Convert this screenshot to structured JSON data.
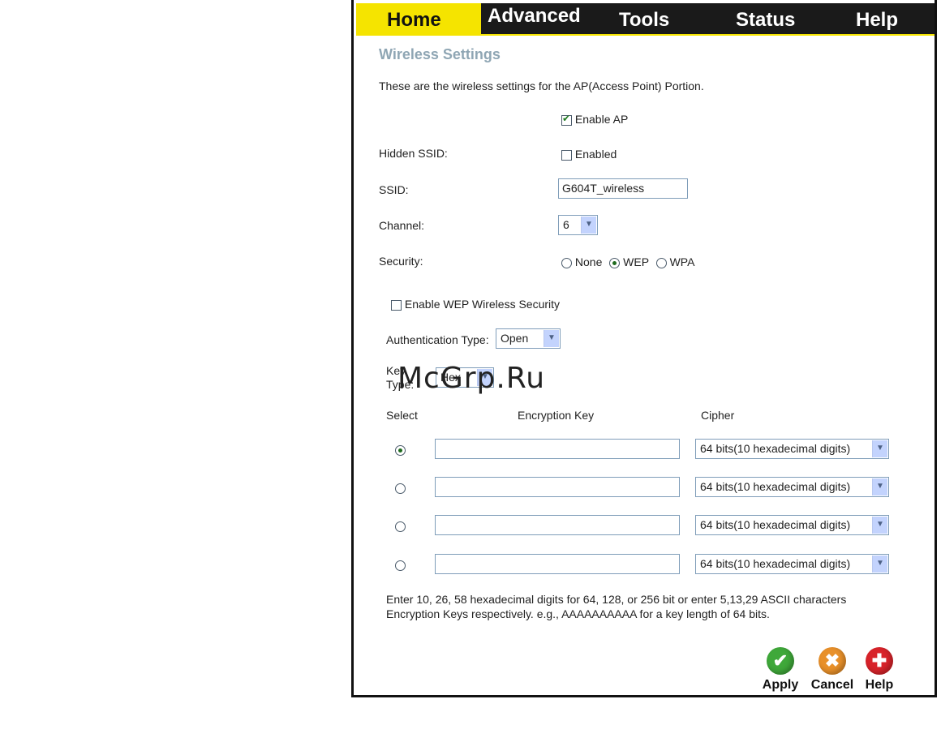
{
  "nav": {
    "tabs": [
      {
        "label": "Home"
      },
      {
        "label": "Advanced"
      },
      {
        "label": "Tools"
      },
      {
        "label": "Status"
      },
      {
        "label": "Help"
      }
    ]
  },
  "page": {
    "title": "Wireless Settings",
    "description": "These are the wireless settings for the AP(Access Point) Portion."
  },
  "form": {
    "enable_ap_label": "Enable AP",
    "enable_ap_checked": true,
    "hidden_ssid_label": "Hidden SSID:",
    "hidden_ssid_option": "Enabled",
    "ssid_label": "SSID:",
    "ssid_value": "G604T_wireless",
    "channel_label": "Channel:",
    "channel_value": "6",
    "security_label": "Security:",
    "security_options": [
      "None",
      "WEP",
      "WPA"
    ],
    "security_selected": "WEP"
  },
  "wep": {
    "enable_label": "Enable WEP Wireless Security",
    "auth_label": "Authentication Type:",
    "auth_value": "Open",
    "key_type_label_1": "Key",
    "key_type_label_2": "Type:",
    "key_type_value": "Hex",
    "headers": {
      "select": "Select",
      "key": "Encryption Key",
      "cipher": "Cipher"
    },
    "rows": [
      {
        "selected": true,
        "key": "",
        "cipher": "64 bits(10 hexadecimal digits)"
      },
      {
        "selected": false,
        "key": "",
        "cipher": "64 bits(10 hexadecimal digits)"
      },
      {
        "selected": false,
        "key": "",
        "cipher": "64 bits(10 hexadecimal digits)"
      },
      {
        "selected": false,
        "key": "",
        "cipher": "64 bits(10 hexadecimal digits)"
      }
    ],
    "note_line1": "Enter 10, 26, 58 hexadecimal digits for 64, 128, or 256 bit or enter 5,13,29 ASCII characters",
    "note_line2": "Encryption Keys respectively. e.g., AAAAAAAAAA for a key length of 64 bits."
  },
  "actions": {
    "apply": "Apply",
    "cancel": "Cancel",
    "help": "Help"
  },
  "watermark": "McGrp.Ru",
  "colors": {
    "tab_active": "#f5e400",
    "tab_bar": "#1a1a1a",
    "title": "#8fa6b4",
    "apply": "#3fa83a",
    "cancel": "#e8902a",
    "help": "#d8232a"
  }
}
